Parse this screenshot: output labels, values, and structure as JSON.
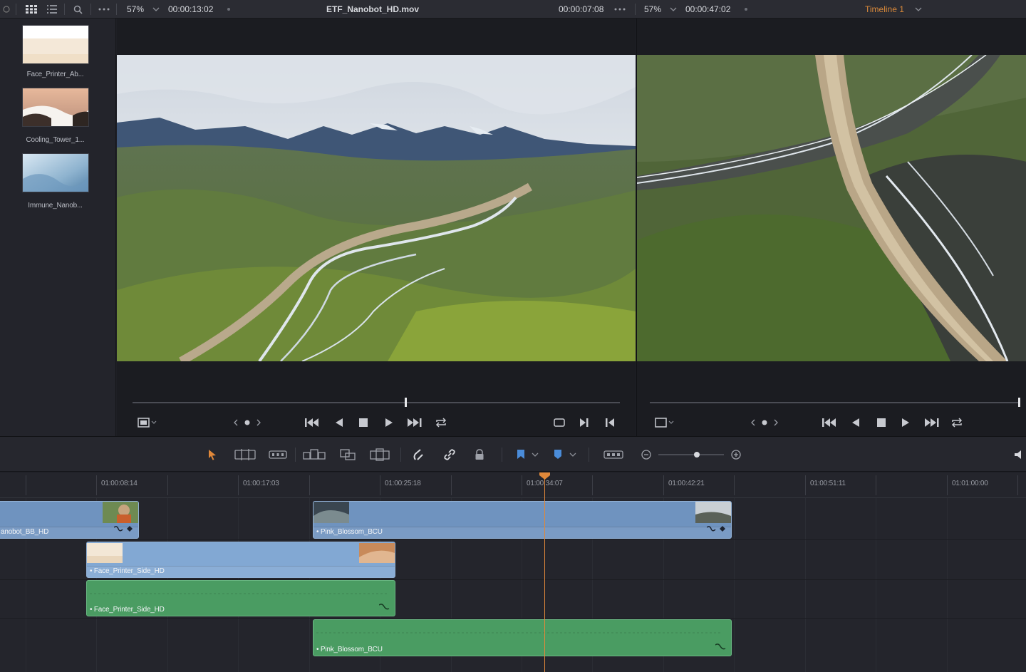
{
  "topbar": {
    "zoom_left": "57%",
    "timecode_left": "00:00:13:02",
    "clip_title": "ETF_Nanobot_HD.mov",
    "timecode_source": "00:00:07:08",
    "zoom_right": "57%",
    "timecode_right": "00:00:47:02",
    "timeline_name": "Timeline 1"
  },
  "media_pool": {
    "clips": [
      {
        "label": "Face_Printer_Ab..."
      },
      {
        "label": "Cooling_Tower_1..."
      },
      {
        "label": "Immune_Nanob..."
      }
    ]
  },
  "ruler": {
    "timecodes": [
      "01:00:08:14",
      "01:00:17:03",
      "01:00:25:18",
      "01:00:34:07",
      "01:00:42:21",
      "01:00:51:11",
      "01:01:00:00"
    ]
  },
  "tracks": {
    "v2_clip_a": "anobot_BB_HD",
    "v2_clip_b": "Pink_Blossom_BCU",
    "v1_clip": "Face_Printer_Side_HD",
    "a1_clip": "Face_Printer_Side_HD",
    "a2_clip": "Pink_Blossom_BCU"
  },
  "colors": {
    "accent_orange": "#e0883a",
    "video_clip": "#6f93bf",
    "audio_clip": "#4a9c62"
  }
}
